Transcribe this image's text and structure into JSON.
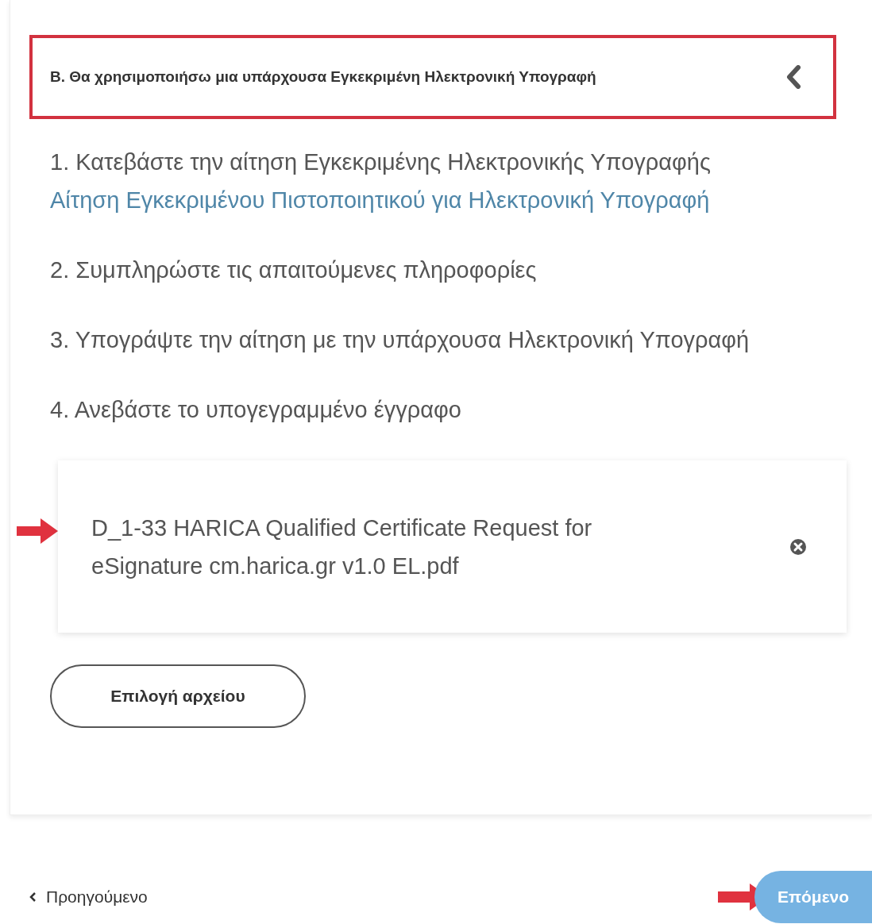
{
  "section": {
    "title": "Β. Θα χρησιμοποιήσω μια υπάρχουσα Εγκεκριμένη Ηλεκτρονική Υπογραφή"
  },
  "steps": [
    {
      "text": "1. Κατεβάστε την αίτηση Εγκεκριμένης Ηλεκτρονικής Υπογραφής",
      "link": "Αίτηση Εγκεκριμένου Πιστοποιητικού για Ηλεκτρονική Υπογραφή"
    },
    {
      "text": "2. Συμπληρώστε τις απαιτούμενες πληροφορίες"
    },
    {
      "text": "3. Υπογράψτε την αίτηση με την υπάρχουσα Ηλεκτρονική Υπογραφή"
    },
    {
      "text": "4. Ανεβάστε το υπογεγραμμένο έγγραφο"
    }
  ],
  "file": {
    "name": "D_1-33 HARICA Qualified Certificate Request for eSignature cm.harica.gr v1.0 EL.pdf"
  },
  "choose_button": "Επιλογή αρχείου",
  "footer": {
    "previous": "Προηγούμενο",
    "next": "Επόμενο"
  }
}
